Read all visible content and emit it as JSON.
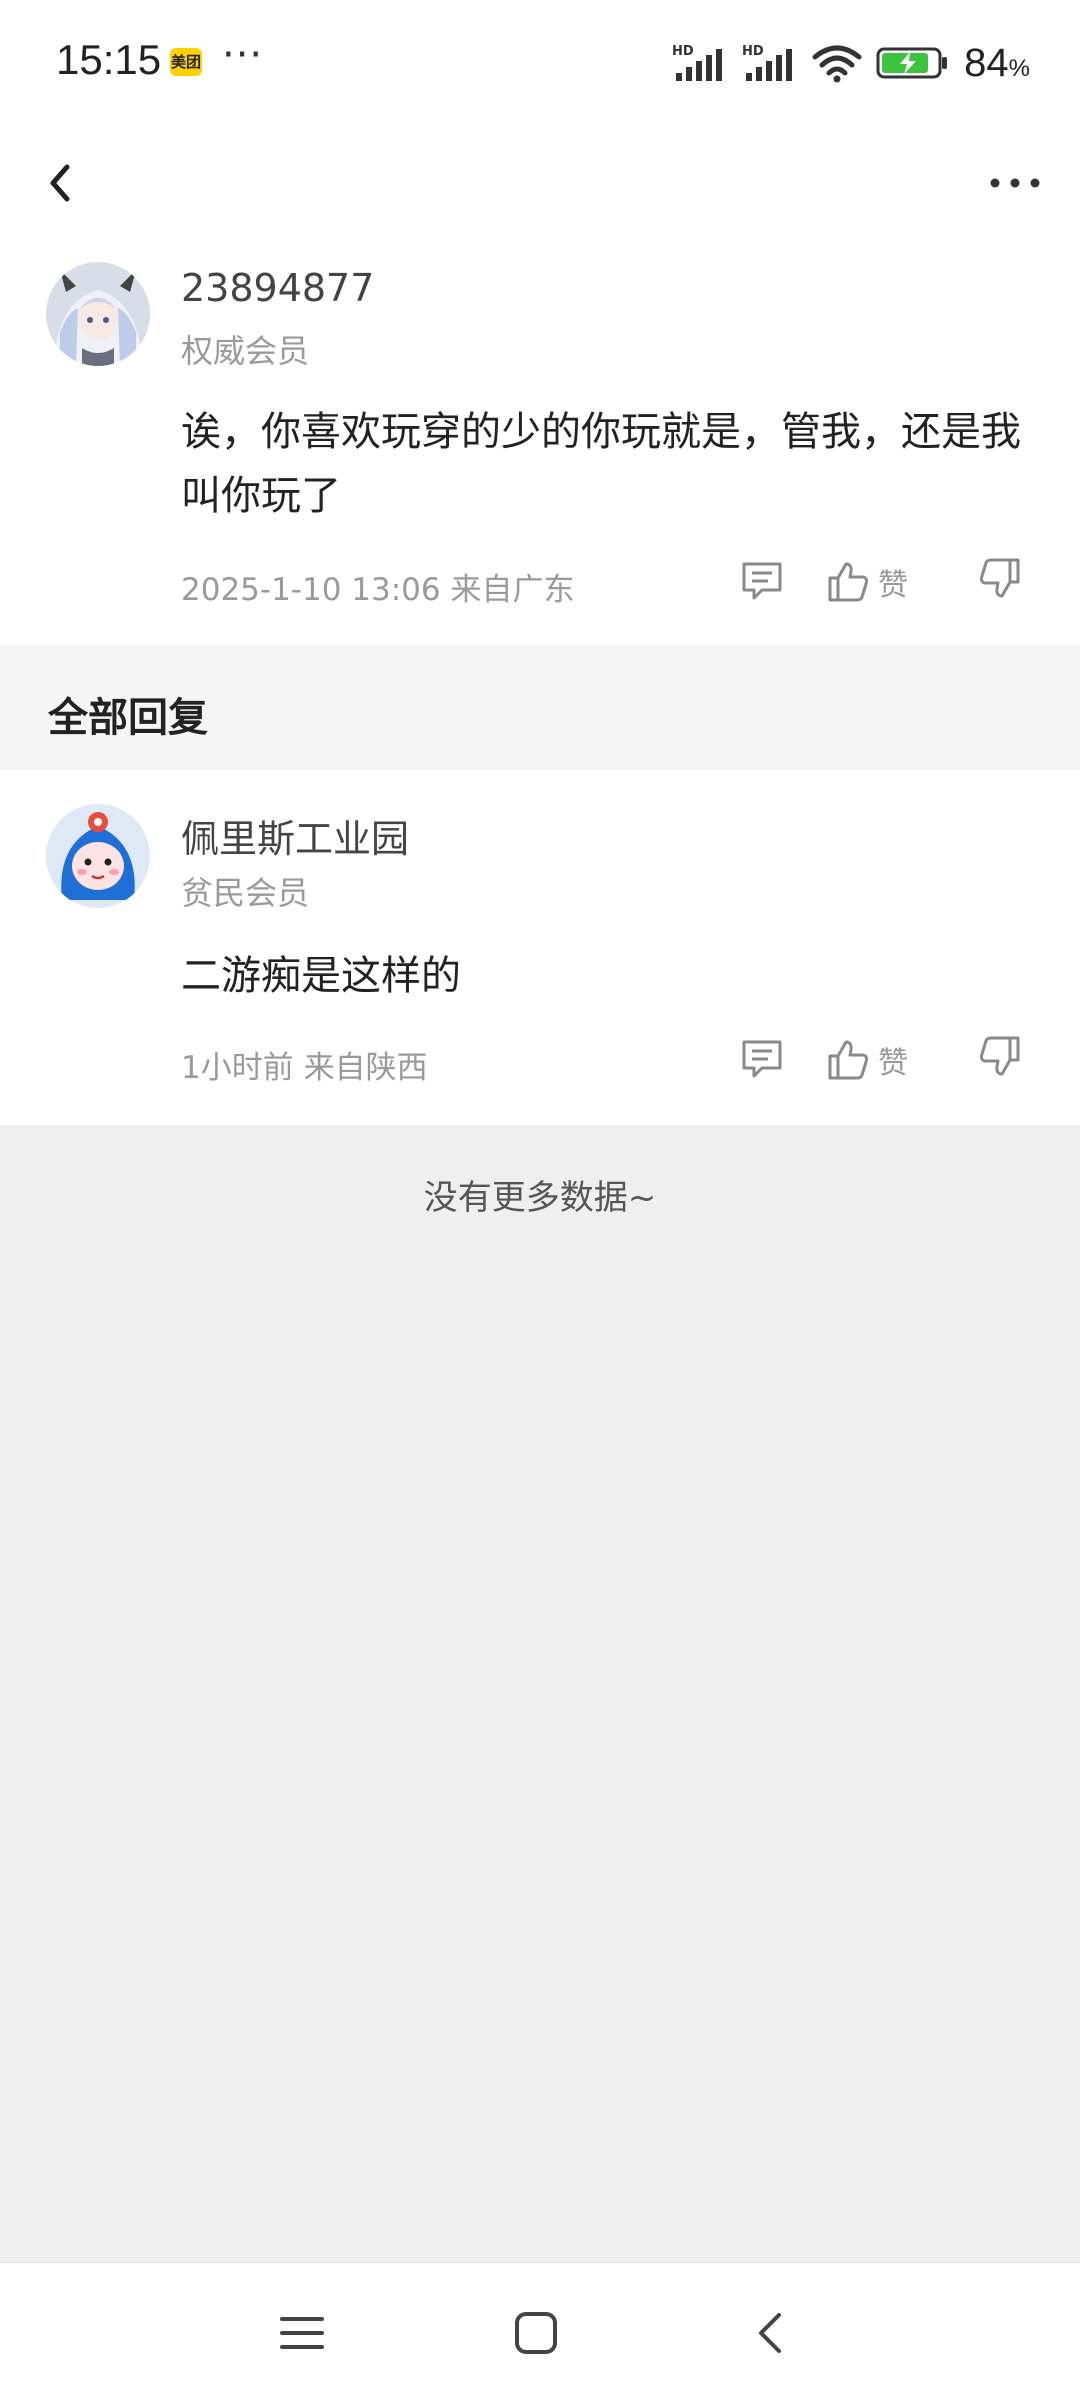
{
  "status_bar": {
    "time": "15:15",
    "app_badge": "美团",
    "dots": "···",
    "signal_label_1": "HD",
    "signal_label_2": "HD",
    "battery_percent": "84",
    "battery_unit": "%"
  },
  "post": {
    "username": "23894877",
    "level": "权威会员",
    "content": "诶，你喜欢玩穿的少的你玩就是，管我，还是我叫你玩了",
    "meta": "2025-1-10 13:06  来自广东",
    "like_label": "赞"
  },
  "replies_section": {
    "title": "全部回复"
  },
  "reply": {
    "username": "佩里斯工业园",
    "level": "贫民会员",
    "content": "二游痴是这样的",
    "meta": "1小时前 来自陕西",
    "like_label": "赞"
  },
  "footer": {
    "no_more": "没有更多数据~"
  },
  "colors": {
    "accent_battery": "#3cc43c",
    "background": "#efefef",
    "text_secondary": "#9a9a9a"
  }
}
